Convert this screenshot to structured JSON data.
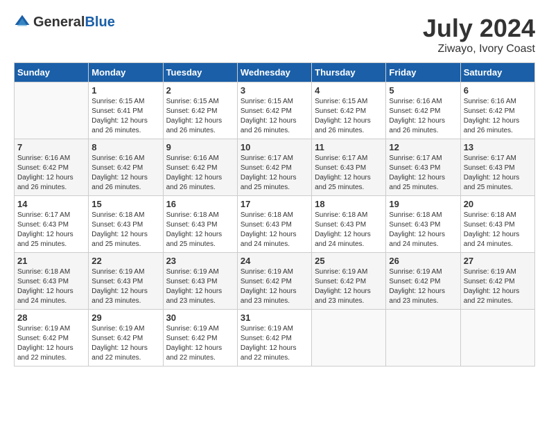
{
  "header": {
    "logo_general": "General",
    "logo_blue": "Blue",
    "month_title": "July 2024",
    "location": "Ziwayo, Ivory Coast"
  },
  "days_of_week": [
    "Sunday",
    "Monday",
    "Tuesday",
    "Wednesday",
    "Thursday",
    "Friday",
    "Saturday"
  ],
  "weeks": [
    [
      {
        "day": "",
        "sunrise": "",
        "sunset": "",
        "daylight": ""
      },
      {
        "day": "1",
        "sunrise": "Sunrise: 6:15 AM",
        "sunset": "Sunset: 6:41 PM",
        "daylight": "Daylight: 12 hours and 26 minutes."
      },
      {
        "day": "2",
        "sunrise": "Sunrise: 6:15 AM",
        "sunset": "Sunset: 6:42 PM",
        "daylight": "Daylight: 12 hours and 26 minutes."
      },
      {
        "day": "3",
        "sunrise": "Sunrise: 6:15 AM",
        "sunset": "Sunset: 6:42 PM",
        "daylight": "Daylight: 12 hours and 26 minutes."
      },
      {
        "day": "4",
        "sunrise": "Sunrise: 6:15 AM",
        "sunset": "Sunset: 6:42 PM",
        "daylight": "Daylight: 12 hours and 26 minutes."
      },
      {
        "day": "5",
        "sunrise": "Sunrise: 6:16 AM",
        "sunset": "Sunset: 6:42 PM",
        "daylight": "Daylight: 12 hours and 26 minutes."
      },
      {
        "day": "6",
        "sunrise": "Sunrise: 6:16 AM",
        "sunset": "Sunset: 6:42 PM",
        "daylight": "Daylight: 12 hours and 26 minutes."
      }
    ],
    [
      {
        "day": "7",
        "sunrise": "Sunrise: 6:16 AM",
        "sunset": "Sunset: 6:42 PM",
        "daylight": "Daylight: 12 hours and 26 minutes."
      },
      {
        "day": "8",
        "sunrise": "Sunrise: 6:16 AM",
        "sunset": "Sunset: 6:42 PM",
        "daylight": "Daylight: 12 hours and 26 minutes."
      },
      {
        "day": "9",
        "sunrise": "Sunrise: 6:16 AM",
        "sunset": "Sunset: 6:42 PM",
        "daylight": "Daylight: 12 hours and 26 minutes."
      },
      {
        "day": "10",
        "sunrise": "Sunrise: 6:17 AM",
        "sunset": "Sunset: 6:42 PM",
        "daylight": "Daylight: 12 hours and 25 minutes."
      },
      {
        "day": "11",
        "sunrise": "Sunrise: 6:17 AM",
        "sunset": "Sunset: 6:43 PM",
        "daylight": "Daylight: 12 hours and 25 minutes."
      },
      {
        "day": "12",
        "sunrise": "Sunrise: 6:17 AM",
        "sunset": "Sunset: 6:43 PM",
        "daylight": "Daylight: 12 hours and 25 minutes."
      },
      {
        "day": "13",
        "sunrise": "Sunrise: 6:17 AM",
        "sunset": "Sunset: 6:43 PM",
        "daylight": "Daylight: 12 hours and 25 minutes."
      }
    ],
    [
      {
        "day": "14",
        "sunrise": "Sunrise: 6:17 AM",
        "sunset": "Sunset: 6:43 PM",
        "daylight": "Daylight: 12 hours and 25 minutes."
      },
      {
        "day": "15",
        "sunrise": "Sunrise: 6:18 AM",
        "sunset": "Sunset: 6:43 PM",
        "daylight": "Daylight: 12 hours and 25 minutes."
      },
      {
        "day": "16",
        "sunrise": "Sunrise: 6:18 AM",
        "sunset": "Sunset: 6:43 PM",
        "daylight": "Daylight: 12 hours and 25 minutes."
      },
      {
        "day": "17",
        "sunrise": "Sunrise: 6:18 AM",
        "sunset": "Sunset: 6:43 PM",
        "daylight": "Daylight: 12 hours and 24 minutes."
      },
      {
        "day": "18",
        "sunrise": "Sunrise: 6:18 AM",
        "sunset": "Sunset: 6:43 PM",
        "daylight": "Daylight: 12 hours and 24 minutes."
      },
      {
        "day": "19",
        "sunrise": "Sunrise: 6:18 AM",
        "sunset": "Sunset: 6:43 PM",
        "daylight": "Daylight: 12 hours and 24 minutes."
      },
      {
        "day": "20",
        "sunrise": "Sunrise: 6:18 AM",
        "sunset": "Sunset: 6:43 PM",
        "daylight": "Daylight: 12 hours and 24 minutes."
      }
    ],
    [
      {
        "day": "21",
        "sunrise": "Sunrise: 6:18 AM",
        "sunset": "Sunset: 6:43 PM",
        "daylight": "Daylight: 12 hours and 24 minutes."
      },
      {
        "day": "22",
        "sunrise": "Sunrise: 6:19 AM",
        "sunset": "Sunset: 6:43 PM",
        "daylight": "Daylight: 12 hours and 23 minutes."
      },
      {
        "day": "23",
        "sunrise": "Sunrise: 6:19 AM",
        "sunset": "Sunset: 6:43 PM",
        "daylight": "Daylight: 12 hours and 23 minutes."
      },
      {
        "day": "24",
        "sunrise": "Sunrise: 6:19 AM",
        "sunset": "Sunset: 6:42 PM",
        "daylight": "Daylight: 12 hours and 23 minutes."
      },
      {
        "day": "25",
        "sunrise": "Sunrise: 6:19 AM",
        "sunset": "Sunset: 6:42 PM",
        "daylight": "Daylight: 12 hours and 23 minutes."
      },
      {
        "day": "26",
        "sunrise": "Sunrise: 6:19 AM",
        "sunset": "Sunset: 6:42 PM",
        "daylight": "Daylight: 12 hours and 23 minutes."
      },
      {
        "day": "27",
        "sunrise": "Sunrise: 6:19 AM",
        "sunset": "Sunset: 6:42 PM",
        "daylight": "Daylight: 12 hours and 22 minutes."
      }
    ],
    [
      {
        "day": "28",
        "sunrise": "Sunrise: 6:19 AM",
        "sunset": "Sunset: 6:42 PM",
        "daylight": "Daylight: 12 hours and 22 minutes."
      },
      {
        "day": "29",
        "sunrise": "Sunrise: 6:19 AM",
        "sunset": "Sunset: 6:42 PM",
        "daylight": "Daylight: 12 hours and 22 minutes."
      },
      {
        "day": "30",
        "sunrise": "Sunrise: 6:19 AM",
        "sunset": "Sunset: 6:42 PM",
        "daylight": "Daylight: 12 hours and 22 minutes."
      },
      {
        "day": "31",
        "sunrise": "Sunrise: 6:19 AM",
        "sunset": "Sunset: 6:42 PM",
        "daylight": "Daylight: 12 hours and 22 minutes."
      },
      {
        "day": "",
        "sunrise": "",
        "sunset": "",
        "daylight": ""
      },
      {
        "day": "",
        "sunrise": "",
        "sunset": "",
        "daylight": ""
      },
      {
        "day": "",
        "sunrise": "",
        "sunset": "",
        "daylight": ""
      }
    ]
  ]
}
